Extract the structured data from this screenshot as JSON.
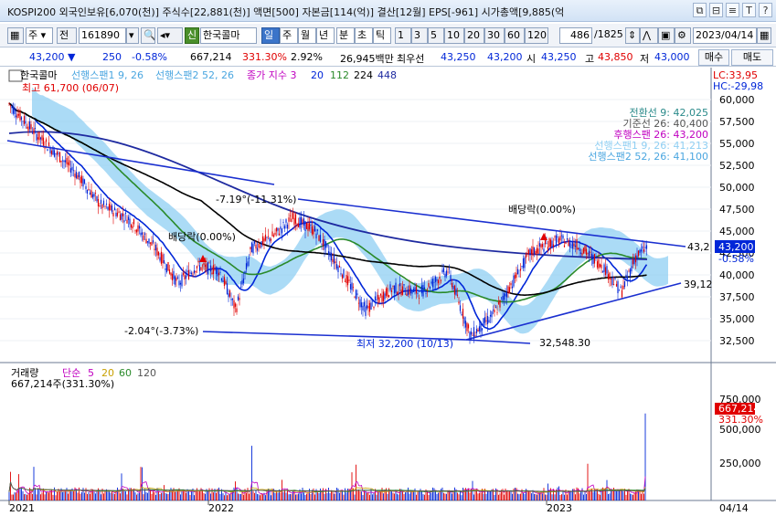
{
  "window": {
    "title": "KOSPI200 외국인보유[6,070(천)] 주식수[22,881(천)] 액면[500] 자본금[114(억)] 결산[12월] EPS[-961] 시가총액[9,885(억",
    "buttons": [
      "⧉",
      "⊟",
      "≡",
      "T",
      "?"
    ]
  },
  "toolbar": {
    "market": "주",
    "jeon": "전",
    "code": "161890",
    "stock_name": "한국콜마",
    "sin": "신",
    "periods": [
      "일",
      "주",
      "월",
      "년",
      "분",
      "초",
      "틱"
    ],
    "active_period": "일",
    "intervals": [
      "1",
      "3",
      "5",
      "10",
      "20",
      "30",
      "60",
      "120"
    ],
    "count": "486",
    "total": "/1825",
    "date": "2023/04/14"
  },
  "quote": {
    "price": "43,200",
    "down_arrow": "▼",
    "change": "250",
    "change_pct": "-0.58%",
    "volume": "667,214",
    "volume_ratio": "331.30%",
    "turnover": "2.92%",
    "amount": "26,945백만",
    "best_label": "최우선",
    "best_ask": "43,250",
    "best_bid": "43,200",
    "open_label": "시",
    "open": "43,250",
    "high_label": "고",
    "high": "43,850",
    "low_label": "저",
    "low": "43,000",
    "sell": "매수",
    "buy": "매도"
  },
  "price_panel": {
    "legend_stock": "한국콜마",
    "legend_span1": "선행스팬1 9, 26",
    "legend_span2": "선행스팬2 52, 26",
    "legend_ma": "종가 지수 3",
    "ma_periods": [
      "20",
      "112",
      "224",
      "448"
    ],
    "high_note": "최고 61,700 (06/07)",
    "lc": "LC:33,95",
    "hc": "HC:-29,98",
    "ichimoku": [
      "전환선 9: 42,025",
      "기준선 26: 40,400",
      "후행스팬 26: 43,200",
      "선행스팬1 9, 26: 41,213",
      "선행스팬2 52, 26: 41,100"
    ],
    "annotations": {
      "div1": "배당락(0.00%)",
      "div2": "배당락(0.00%)",
      "trend_top": "-7.19°(-11.31%)",
      "trend_bottom": "-2.04°(-3.73%)",
      "low_note": "최저 32,200 (10/13)",
      "level_low": "32,548.30",
      "right_top": "43,2",
      "right_bottom": "39,12"
    },
    "current_price": "43,200",
    "current_pct": "-0.58%",
    "axis": [
      "60,000",
      "57,500",
      "55,000",
      "52,500",
      "50,000",
      "47,500",
      "45,000",
      "42,500",
      "40,000",
      "37,500",
      "35,000",
      "32,500"
    ]
  },
  "volume_panel": {
    "legend_label": "거래량",
    "legend_type": "단순",
    "ma_periods": [
      "5",
      "20",
      "60",
      "120"
    ],
    "value": "667,214주(331.30%)",
    "current": "667,214",
    "current_pct": "331.30%",
    "axis": [
      "750,000",
      "500,000",
      "250,000"
    ]
  },
  "x_axis": {
    "labels": [
      "2021",
      "2022",
      "2023"
    ],
    "date_tag": "04/14"
  },
  "colors": {
    "up": "#e00000",
    "down": "#0026d8",
    "cloud": "#8fcff3",
    "ma20": "#0026d8",
    "ma112": "#2a8a2a",
    "ma224": "#000000",
    "ma448": "#1e2aa0",
    "trendline": "#1a2fd0",
    "vol_ma5": "#c000c0",
    "vol_ma20": "#c8a000",
    "vol_ma60": "#2a8a2a",
    "vol_ma120": "#555555"
  }
}
